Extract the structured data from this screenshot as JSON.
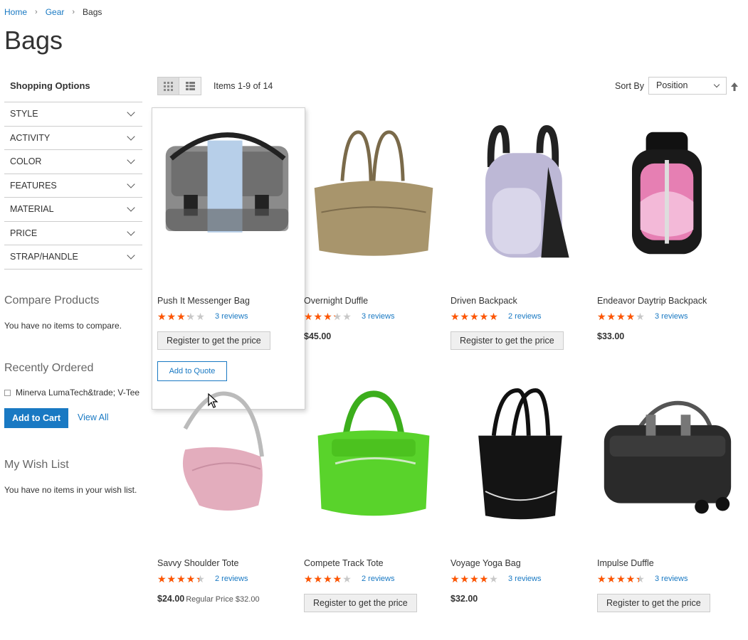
{
  "breadcrumbs": [
    {
      "label": "Home"
    },
    {
      "label": "Gear"
    },
    {
      "label": "Bags"
    }
  ],
  "page_title": "Bags",
  "sidebar": {
    "shopping_options_title": "Shopping Options",
    "filters": [
      "STYLE",
      "ACTIVITY",
      "COLOR",
      "FEATURES",
      "MATERIAL",
      "PRICE",
      "STRAP/HANDLE"
    ],
    "compare": {
      "title": "Compare Products",
      "text": "You have no items to compare."
    },
    "recently_ordered": {
      "title": "Recently Ordered",
      "item": "Minerva LumaTech&trade; V-Tee",
      "add_to_cart": "Add to Cart",
      "view_all": "View All"
    },
    "wishlist": {
      "title": "My Wish List",
      "text": "You have no items in your wish list."
    }
  },
  "toolbar": {
    "view_modes": [
      "grid-icon",
      "list-icon"
    ],
    "amount": "Items 1-9 of 14",
    "sort_label": "Sort By",
    "sort_value": "Position"
  },
  "colors": {
    "accent": "#1979c3",
    "star": "#ff5501"
  },
  "products": [
    {
      "name": "Push It Messenger Bag",
      "rating": 0.6,
      "reviews": "3 reviews",
      "price": "",
      "register": "Register to get the price",
      "quote": "Add to Quote"
    },
    {
      "name": "Overnight Duffle",
      "rating": 0.6,
      "reviews": "3 reviews",
      "price": "$45.00"
    },
    {
      "name": "Driven Backpack",
      "rating": 0.9,
      "reviews": "2 reviews",
      "register": "Register to get the price"
    },
    {
      "name": "Endeavor Daytrip Backpack",
      "rating": 0.7,
      "reviews": "3 reviews",
      "price": "$33.00"
    },
    {
      "name": "Savvy Shoulder Tote",
      "rating": 0.8,
      "reviews": "2 reviews",
      "price": "$24.00",
      "old_price": "Regular Price $32.00"
    },
    {
      "name": "Compete Track Tote",
      "rating": 0.7,
      "reviews": "2 reviews",
      "register": "Register to get the price"
    },
    {
      "name": "Voyage Yoga Bag",
      "rating": 0.7,
      "reviews": "3 reviews",
      "price": "$32.00"
    },
    {
      "name": "Impulse Duffle",
      "rating": 0.8,
      "reviews": "3 reviews",
      "register": "Register to get the price"
    }
  ]
}
